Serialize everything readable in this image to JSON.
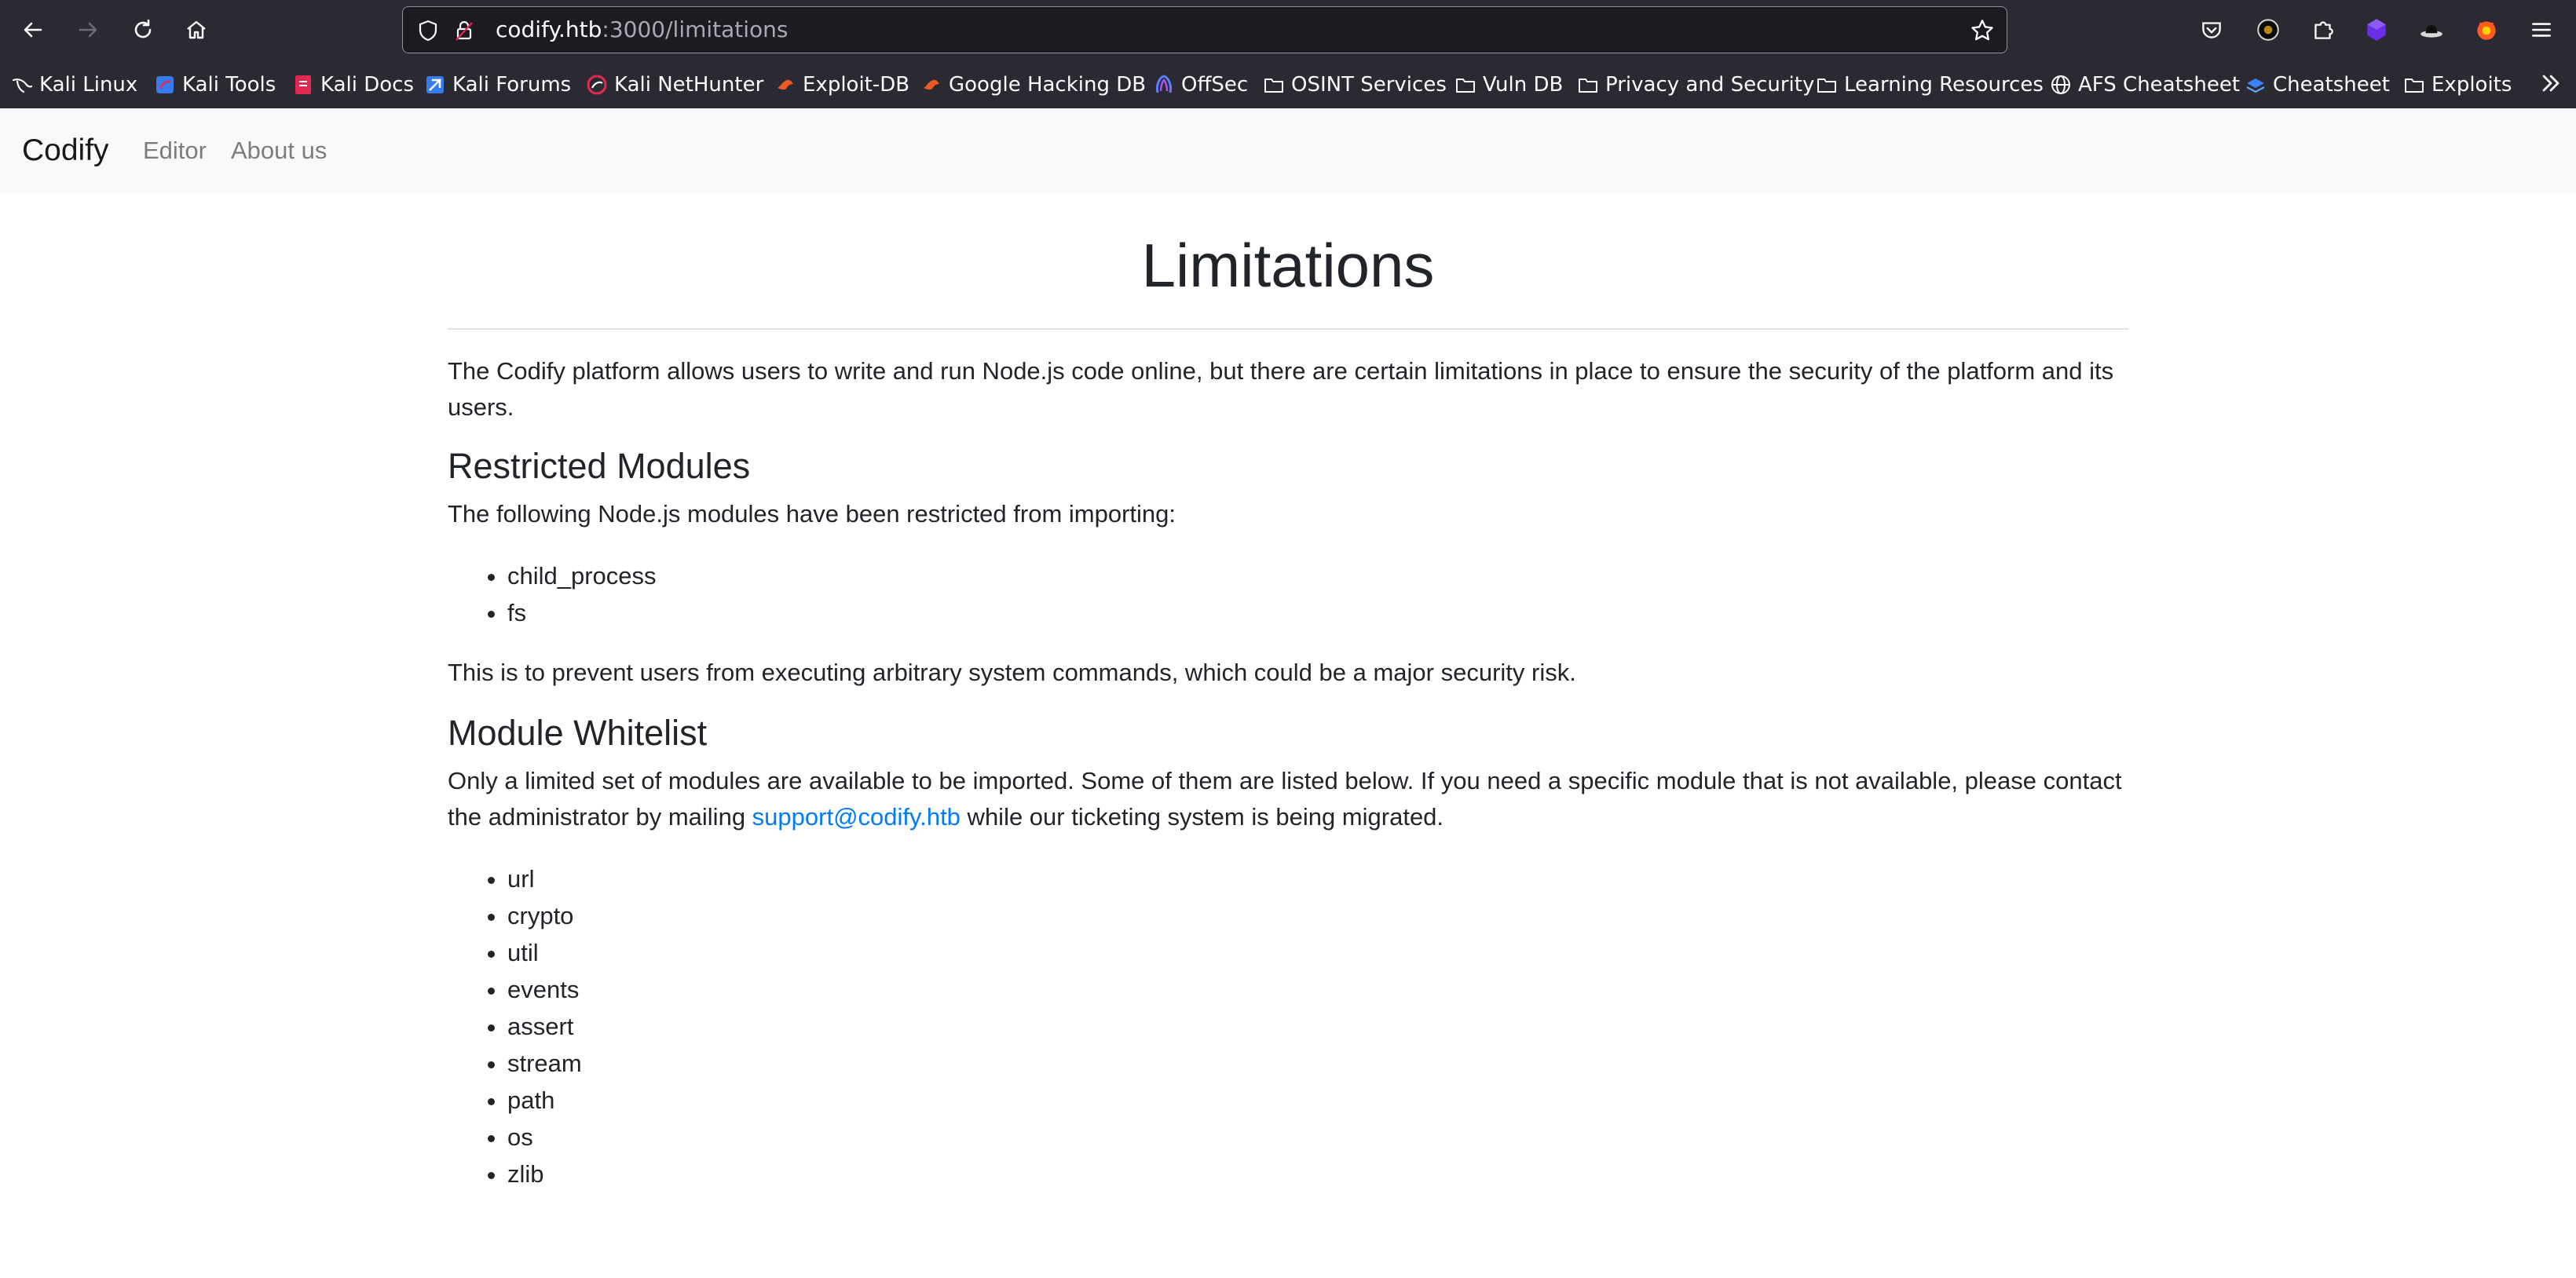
{
  "browser": {
    "url_host": "codify.htb",
    "url_path": ":3000/limitations",
    "bookmarks": [
      {
        "label": "Kali Linux",
        "icon": "kali-dragon-icon"
      },
      {
        "label": "Kali Tools",
        "icon": "kali-tools-icon"
      },
      {
        "label": "Kali Docs",
        "icon": "kali-docs-icon"
      },
      {
        "label": "Kali Forums",
        "icon": "kali-forums-icon"
      },
      {
        "label": "Kali NetHunter",
        "icon": "nethunter-icon"
      },
      {
        "label": "Exploit-DB",
        "icon": "exploit-db-icon"
      },
      {
        "label": "Google Hacking DB",
        "icon": "ghdb-icon"
      },
      {
        "label": "OffSec",
        "icon": "offsec-icon"
      },
      {
        "label": "OSINT Services",
        "icon": "folder-icon"
      },
      {
        "label": "Vuln DB",
        "icon": "folder-icon"
      },
      {
        "label": "Privacy and Security",
        "icon": "folder-icon"
      },
      {
        "label": "Learning Resources",
        "icon": "folder-icon"
      },
      {
        "label": "AFS Cheatsheet",
        "icon": "globe-icon"
      },
      {
        "label": "Cheatsheet",
        "icon": "cheatsheet-icon"
      },
      {
        "label": "Exploits",
        "icon": "folder-icon"
      }
    ]
  },
  "site": {
    "brand": "Codify",
    "nav": {
      "editor": "Editor",
      "about": "About us"
    }
  },
  "page": {
    "title": "Limitations",
    "intro": "The Codify platform allows users to write and run Node.js code online, but there are certain limitations in place to ensure the security of the platform and its users.",
    "restricted": {
      "heading": "Restricted Modules",
      "text": "The following Node.js modules have been restricted from importing:",
      "modules": [
        "child_process",
        "fs"
      ],
      "note": "This is to prevent users from executing arbitrary system commands, which could be a major security risk."
    },
    "whitelist": {
      "heading": "Module Whitelist",
      "text_before": "Only a limited set of modules are available to be imported. Some of them are listed below. If you need a specific module that is not available, please contact the administrator by mailing ",
      "email": "support@codify.htb",
      "text_after": " while our ticketing system is being migrated.",
      "modules": [
        "url",
        "crypto",
        "util",
        "events",
        "assert",
        "stream",
        "path",
        "os",
        "zlib"
      ]
    }
  },
  "colors": {
    "chrome_bg": "#2b2a33",
    "urlbar_bg": "#1c1b22",
    "navbar_bg": "#f8f9fa",
    "link": "#007bff",
    "text": "#212529"
  }
}
